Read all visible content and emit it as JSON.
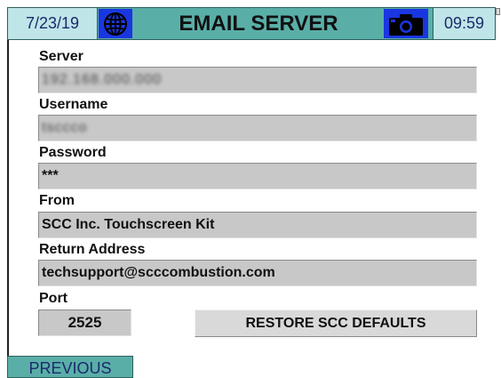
{
  "header": {
    "date": "7/23/19",
    "title": "EMAIL SERVER",
    "time": "09:59",
    "globe_icon": "globe-icon",
    "camera_icon": "camera-icon"
  },
  "form": {
    "server": {
      "label": "Server",
      "value": "192.168.000.000"
    },
    "username": {
      "label": "Username",
      "value": "tsccco"
    },
    "password": {
      "label": "Password",
      "value": "***"
    },
    "from": {
      "label": "From",
      "value": "SCC Inc. Touchscreen Kit"
    },
    "return_address": {
      "label": "Return Address",
      "value": "techsupport@scccombustion.com"
    },
    "port": {
      "label": "Port",
      "value": "2525"
    }
  },
  "buttons": {
    "restore_defaults": "RESTORE SCC DEFAULTS",
    "previous": "PREVIOUS"
  },
  "colors": {
    "teal": "#5aaea8",
    "light_teal": "#bfe5e8",
    "blue_button": "#1a36e0",
    "field_gray": "#c8c8c8"
  }
}
